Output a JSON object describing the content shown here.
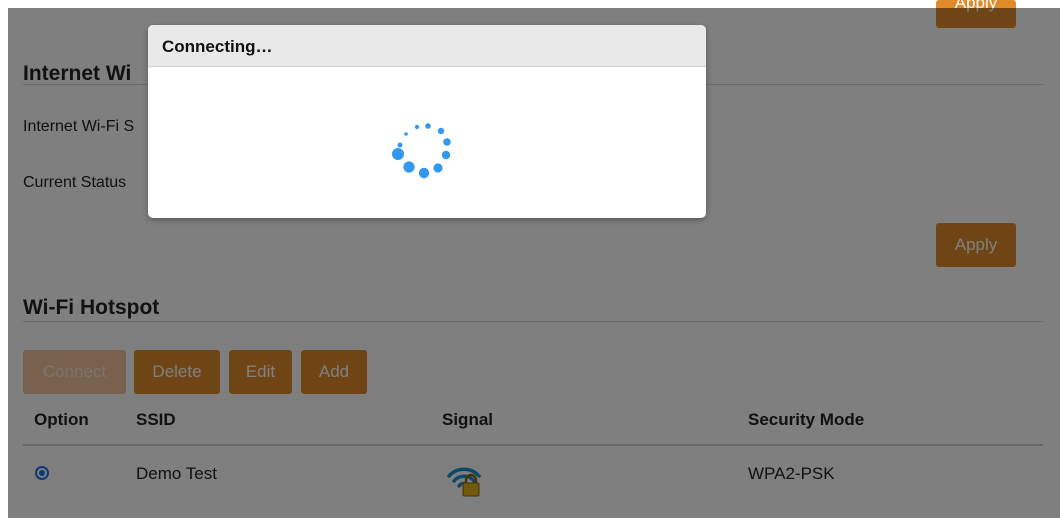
{
  "internet_wifi": {
    "title": "Internet Wi",
    "setting_label": "Internet Wi-Fi S",
    "status_label": "Current Status",
    "apply_label": "Apply",
    "top_apply_label": "Apply"
  },
  "hotspot": {
    "title": "Wi-Fi Hotspot",
    "buttons": {
      "connect": "Connect",
      "delete": "Delete",
      "edit": "Edit",
      "add": "Add"
    },
    "columns": [
      "Option",
      "SSID",
      "Signal",
      "Security Mode"
    ],
    "rows": [
      {
        "selected": true,
        "ssid": "Demo Test",
        "signal_icon": "wifi-locked-icon",
        "security": "WPA2-PSK"
      }
    ]
  },
  "modal": {
    "title": "Connecting…",
    "spinner_icon": "loading-spinner-icon"
  },
  "colors": {
    "accent": "#e08a2a",
    "spinner": "#3399ee",
    "overlay": "rgba(0,0,0,0.5)"
  }
}
